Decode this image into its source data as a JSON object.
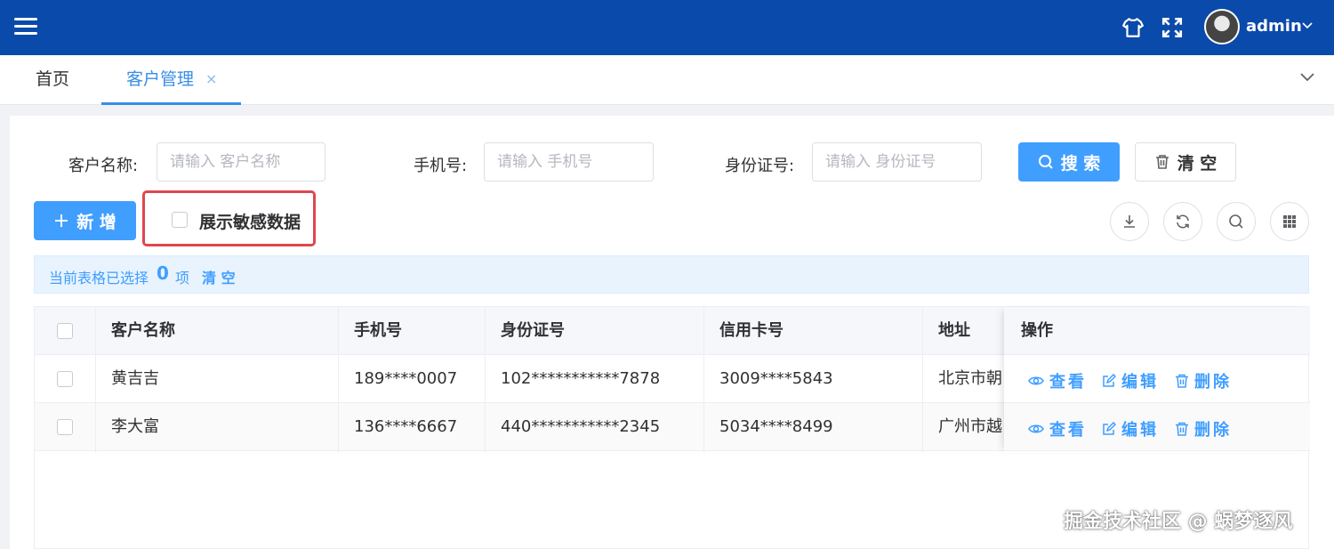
{
  "header": {
    "username": "admin"
  },
  "tabs": [
    {
      "label": "首页"
    },
    {
      "label": "客户管理"
    }
  ],
  "search_form": {
    "name_label": "客户名称:",
    "name_placeholder": "请输入 客户名称",
    "phone_label": "手机号:",
    "phone_placeholder": "请输入 手机号",
    "id_label": "身份证号:",
    "id_placeholder": "请输入 身份证号",
    "search_label": "搜 索",
    "clear_label": "清 空"
  },
  "toolbar": {
    "add_label": "新 增",
    "show_sensitive_label": "展示敏感数据",
    "show_sensitive_checked": false
  },
  "selection": {
    "prefix": "当前表格已选择",
    "count": "0",
    "unit": "项",
    "clear_label": "清 空"
  },
  "table": {
    "columns": [
      "客户名称",
      "手机号",
      "身份证号",
      "信用卡号",
      "地址",
      "操作"
    ],
    "rows": [
      {
        "name": "黄吉吉",
        "phone": "189****0007",
        "id_card": "102***********7878",
        "credit_card": "3009****5843",
        "address": "北京市朝"
      },
      {
        "name": "李大富",
        "phone": "136****6667",
        "id_card": "440***********2345",
        "credit_card": "5034****8499",
        "address": "广州市越"
      }
    ],
    "actions": {
      "view": "查看",
      "edit": "编辑",
      "delete": "删除"
    }
  },
  "watermark": "掘金技术社区 @ 蜗梦逐风",
  "colors": {
    "topbar": "#0a4aab",
    "primary": "#409eff",
    "highlight_border": "#e0474e"
  },
  "icons": [
    "menu-icon",
    "shirt-icon",
    "fullscreen-icon",
    "chevron-down-icon",
    "search-icon",
    "trash-icon",
    "plus-icon",
    "download-icon",
    "refresh-icon",
    "column-settings-icon",
    "eye-icon",
    "edit-icon"
  ]
}
